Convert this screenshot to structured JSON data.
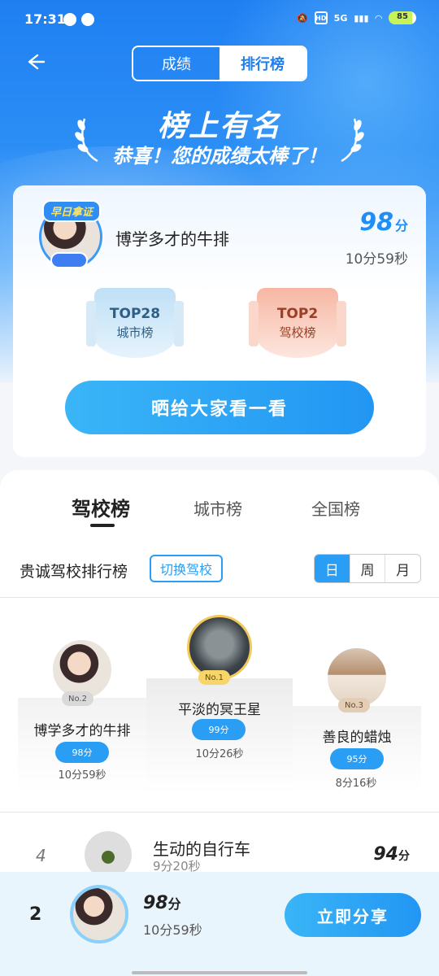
{
  "status_bar": {
    "time": "17:31",
    "battery": "85",
    "network": "5G",
    "hd": "HD"
  },
  "header": {
    "tabs": [
      {
        "label": "成绩"
      },
      {
        "label": "排行榜"
      }
    ],
    "title": "榜上有名",
    "subtitle": "恭喜！您的成绩太棒了！"
  },
  "my_card": {
    "tag": "早日拿证",
    "name": "博学多才的牛排",
    "score": "98",
    "score_unit": "分",
    "time": "10分59秒",
    "badges": [
      {
        "rank": "TOP28",
        "board": "城市榜"
      },
      {
        "rank": "TOP2",
        "board": "驾校榜"
      }
    ],
    "share_label": "晒给大家看一看"
  },
  "ranking": {
    "tabs": [
      {
        "label": "驾校榜"
      },
      {
        "label": "城市榜"
      },
      {
        "label": "全国榜"
      }
    ],
    "school_label": "贵诚驾校排行榜",
    "switch_label": "切换驾校",
    "periods": [
      {
        "label": "日"
      },
      {
        "label": "周"
      },
      {
        "label": "月"
      }
    ],
    "podium": [
      {
        "no": "No.2",
        "name": "博学多才的牛排",
        "score": "98分",
        "time": "10分59秒"
      },
      {
        "no": "No.1",
        "name": "平淡的冥王星",
        "score": "99分",
        "time": "10分26秒"
      },
      {
        "no": "No.3",
        "name": "善良的蜡烛",
        "score": "95分",
        "time": "8分16秒"
      }
    ],
    "list": [
      {
        "rank": "4",
        "name": "生动的自行车",
        "time": "9分20秒",
        "score": "94",
        "unit": "分"
      }
    ]
  },
  "bottom": {
    "rank": "2",
    "score": "98",
    "score_unit": "分",
    "time": "10分59秒",
    "share_label": "立即分享"
  }
}
